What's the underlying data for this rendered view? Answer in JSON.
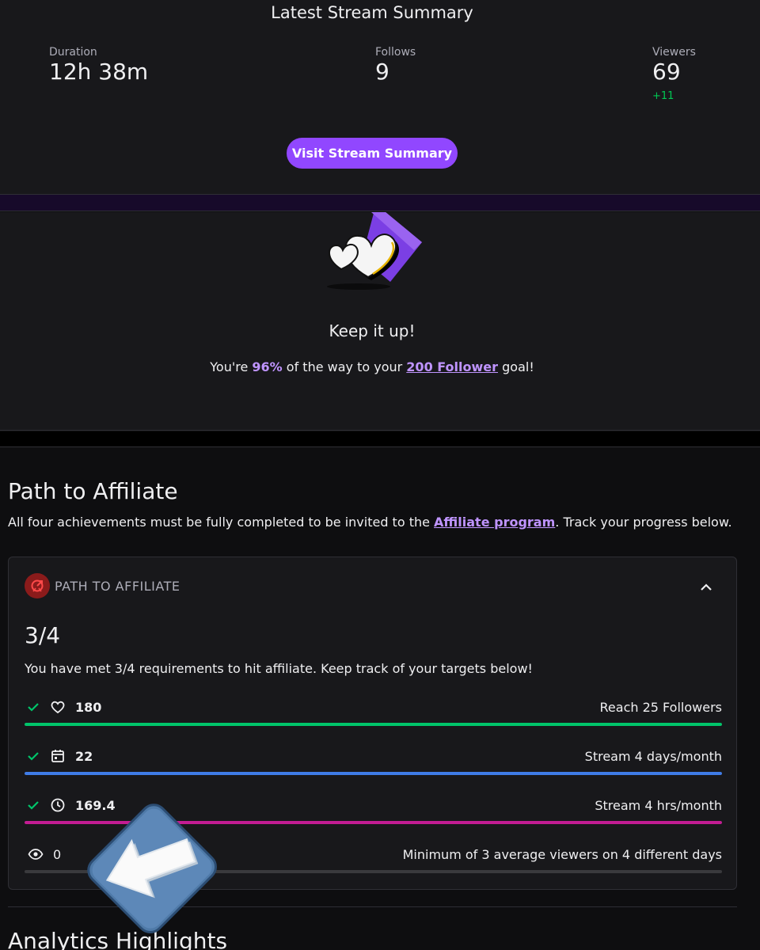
{
  "summary": {
    "title": "Latest Stream Summary",
    "stats": [
      {
        "label": "Duration",
        "value": "12h 38m"
      },
      {
        "label": "Follows",
        "value": "9"
      },
      {
        "label": "Viewers",
        "value": "69",
        "delta": "+11"
      }
    ],
    "button_label": "Visit Stream Summary"
  },
  "goal": {
    "title": "Keep it up!",
    "text_prefix": "You're ",
    "percent": "96%",
    "text_mid": " of the way to your ",
    "goal_link": "200 Follower",
    "text_suffix": " goal!"
  },
  "affiliate": {
    "heading": "Path to Affiliate",
    "desc_prefix": "All four achievements must be fully completed to be invited to the ",
    "desc_link": "Affiliate program",
    "desc_suffix": ". Track your progress below.",
    "card_label": "PATH TO AFFILIATE",
    "ratio": "3/4",
    "card_desc": "You have met 3/4 requirements to hit affiliate. Keep track of your targets below!",
    "requirements": [
      {
        "icon": "heart-icon",
        "value": "180",
        "goal": "Reach 25 Followers",
        "met": true,
        "progress": 1.0,
        "color": "#00c56a"
      },
      {
        "icon": "calendar-icon",
        "value": "22",
        "goal": "Stream 4 days/month",
        "met": true,
        "progress": 1.0,
        "color": "#3f7ce8"
      },
      {
        "icon": "clock-icon",
        "value": "169.4",
        "goal": "Stream 4 hrs/month",
        "met": true,
        "progress": 1.0,
        "color": "#c31c93"
      },
      {
        "icon": "eye-icon",
        "value": "0",
        "goal": "Minimum of 3 average viewers on 4 different days",
        "met": false,
        "progress": 0.0,
        "color": "#3a3a3d"
      }
    ]
  },
  "analytics": {
    "heading": "Analytics Highlights"
  },
  "colors": {
    "accent": "#9147ff",
    "link": "#bf94ff",
    "positive": "#00c853"
  }
}
